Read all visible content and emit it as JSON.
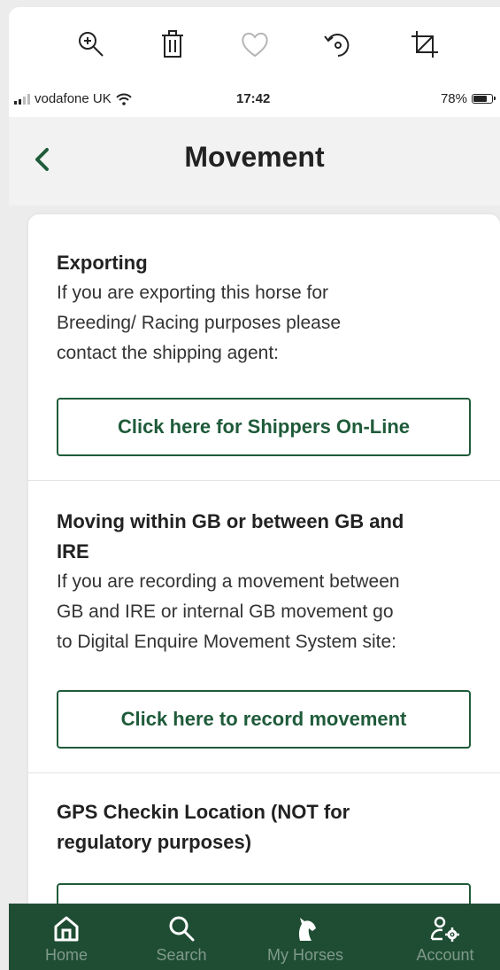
{
  "toolbar": {
    "icons": [
      "zoom-in-icon",
      "trash-icon",
      "heart-icon",
      "rotate-icon",
      "crop-icon"
    ]
  },
  "status_bar": {
    "carrier": "vodafone UK",
    "time": "17:42",
    "battery": "78%",
    "battery_level": 0.78
  },
  "header": {
    "title": "Movement",
    "back_icon": "chevron-left-icon"
  },
  "sections": [
    {
      "title": "Exporting",
      "lines": [
        "If you are exporting this horse for",
        "Breeding/ Racing purposes please",
        "contact the shipping agent:"
      ],
      "button_label": "Click here for Shippers On-Line"
    },
    {
      "title_lines": [
        "Moving within GB or between GB and",
        "IRE"
      ],
      "lines": [
        "If you are recording a movement between",
        "GB and IRE or internal GB movement go",
        "to Digital Enquire Movement System site:"
      ],
      "button_label": "Click here to record movement"
    },
    {
      "title_lines": [
        "GPS Checkin Location (NOT for",
        "regulatory purposes)"
      ]
    }
  ],
  "bottom_nav": {
    "items": [
      {
        "label": "Home",
        "icon": "home-icon"
      },
      {
        "label": "Search",
        "icon": "search-icon"
      },
      {
        "label": "My Horses",
        "icon": "horse-head-icon"
      },
      {
        "label": "Account",
        "icon": "account-settings-icon"
      }
    ]
  },
  "colors": {
    "brand_green": "#1f5b3a",
    "nav_green": "#1f4d33"
  }
}
